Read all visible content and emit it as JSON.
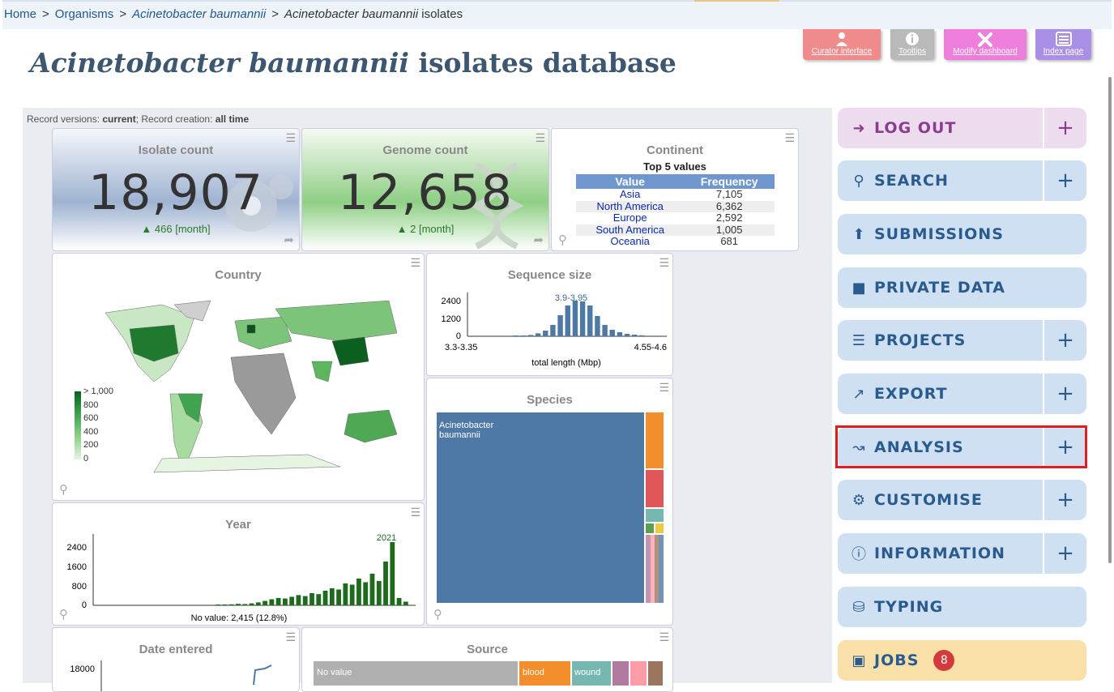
{
  "breadcrumb": {
    "home": "Home",
    "organisms": "Organisms",
    "species": "Acinetobacter baumannii",
    "current_italic": "Acinetobacter baumannii",
    "current_rest": " isolates",
    "separator": ">"
  },
  "page_title": {
    "italic": "Acinetobacter baumannii",
    "rest": " isolates database"
  },
  "toolbar": {
    "curator": "Curator interface",
    "tooltips": "Tooltips",
    "modify": "Modify dashboard",
    "index": "Index page"
  },
  "record_versions": {
    "prefix": "Record versions: ",
    "versions": "current",
    "mid": "; Record creation: ",
    "creation": "all time"
  },
  "widgets": {
    "isolate_count": {
      "title": "Isolate count",
      "value": "18,907",
      "change": "466 [month]"
    },
    "genome_count": {
      "title": "Genome count",
      "value": "12,658",
      "change": "2 [month]"
    },
    "continent": {
      "title": "Continent",
      "subtitle": "Top 5 values",
      "col_value": "Value",
      "col_freq": "Frequency",
      "rows": [
        {
          "value": "Asia",
          "freq": "7,105"
        },
        {
          "value": "North America",
          "freq": "6,362"
        },
        {
          "value": "Europe",
          "freq": "2,592"
        },
        {
          "value": "South America",
          "freq": "1,005"
        },
        {
          "value": "Oceania",
          "freq": "681"
        }
      ]
    },
    "country": {
      "title": "Country",
      "legend": [
        "> 1,000",
        "800",
        "600",
        "400",
        "200",
        "0"
      ]
    },
    "sequence_size": {
      "title": "Sequence size",
      "peak_label": "3.9-3.95",
      "xlabel": "total length (Mbp)",
      "x_left": "3.3-3.35",
      "x_right": "4.55-4.6",
      "yticks": [
        "2400",
        "1200",
        "0"
      ]
    },
    "species": {
      "title": "Species",
      "main_label": "Acinetobacter baumannii"
    },
    "year": {
      "title": "Year",
      "peak_label": "2021",
      "yticks": [
        "2400",
        "1600",
        "800",
        "0"
      ],
      "footer": "No value: 2,415 (12.8%)"
    },
    "date_entered": {
      "title": "Date entered",
      "ytick": "18000"
    },
    "source": {
      "title": "Source",
      "segments": [
        "No value",
        "blood",
        "wound"
      ]
    }
  },
  "chart_data": [
    {
      "type": "bar",
      "title": "Sequence size",
      "xlabel": "total length (Mbp)",
      "ylim": [
        0,
        2600
      ],
      "values": [
        20,
        40,
        80,
        180,
        350,
        700,
        1300,
        1900,
        2200,
        2150,
        1900,
        1250,
        700,
        400,
        250,
        150,
        100,
        60
      ]
    },
    {
      "type": "bar",
      "title": "Year",
      "ylim": [
        0,
        2800
      ],
      "values": [
        20,
        30,
        40,
        60,
        50,
        80,
        120,
        180,
        250,
        300,
        280,
        350,
        420,
        380,
        500,
        460,
        600,
        700,
        650,
        900,
        850,
        1100,
        950,
        1300,
        1000,
        1800,
        2600,
        300,
        150
      ]
    }
  ],
  "sidebar": [
    {
      "label": "LOG OUT",
      "icon": "sign-out-icon",
      "plus": true
    },
    {
      "label": "SEARCH",
      "icon": "search-icon",
      "plus": true
    },
    {
      "label": "SUBMISSIONS",
      "icon": "upload-icon",
      "plus": false
    },
    {
      "label": "PRIVATE DATA",
      "icon": "lock-icon",
      "plus": false
    },
    {
      "label": "PROJECTS",
      "icon": "list-icon",
      "plus": true
    },
    {
      "label": "EXPORT",
      "icon": "external-link-icon",
      "plus": true
    },
    {
      "label": "ANALYSIS",
      "icon": "chart-line-icon",
      "plus": true
    },
    {
      "label": "CUSTOMISE",
      "icon": "gear-icon",
      "plus": true
    },
    {
      "label": "INFORMATION",
      "icon": "info-icon",
      "plus": true
    },
    {
      "label": "TYPING",
      "icon": "database-icon",
      "plus": false
    },
    {
      "label": "JOBS",
      "icon": "briefcase-icon",
      "plus": false,
      "badge": "8"
    }
  ],
  "plus_glyph": "+",
  "colors": {
    "accent": "#2a5b8e",
    "logout": "#8a3d8f",
    "jobs_bg": "#f9dfa8",
    "highlight": "#e01e1e"
  }
}
